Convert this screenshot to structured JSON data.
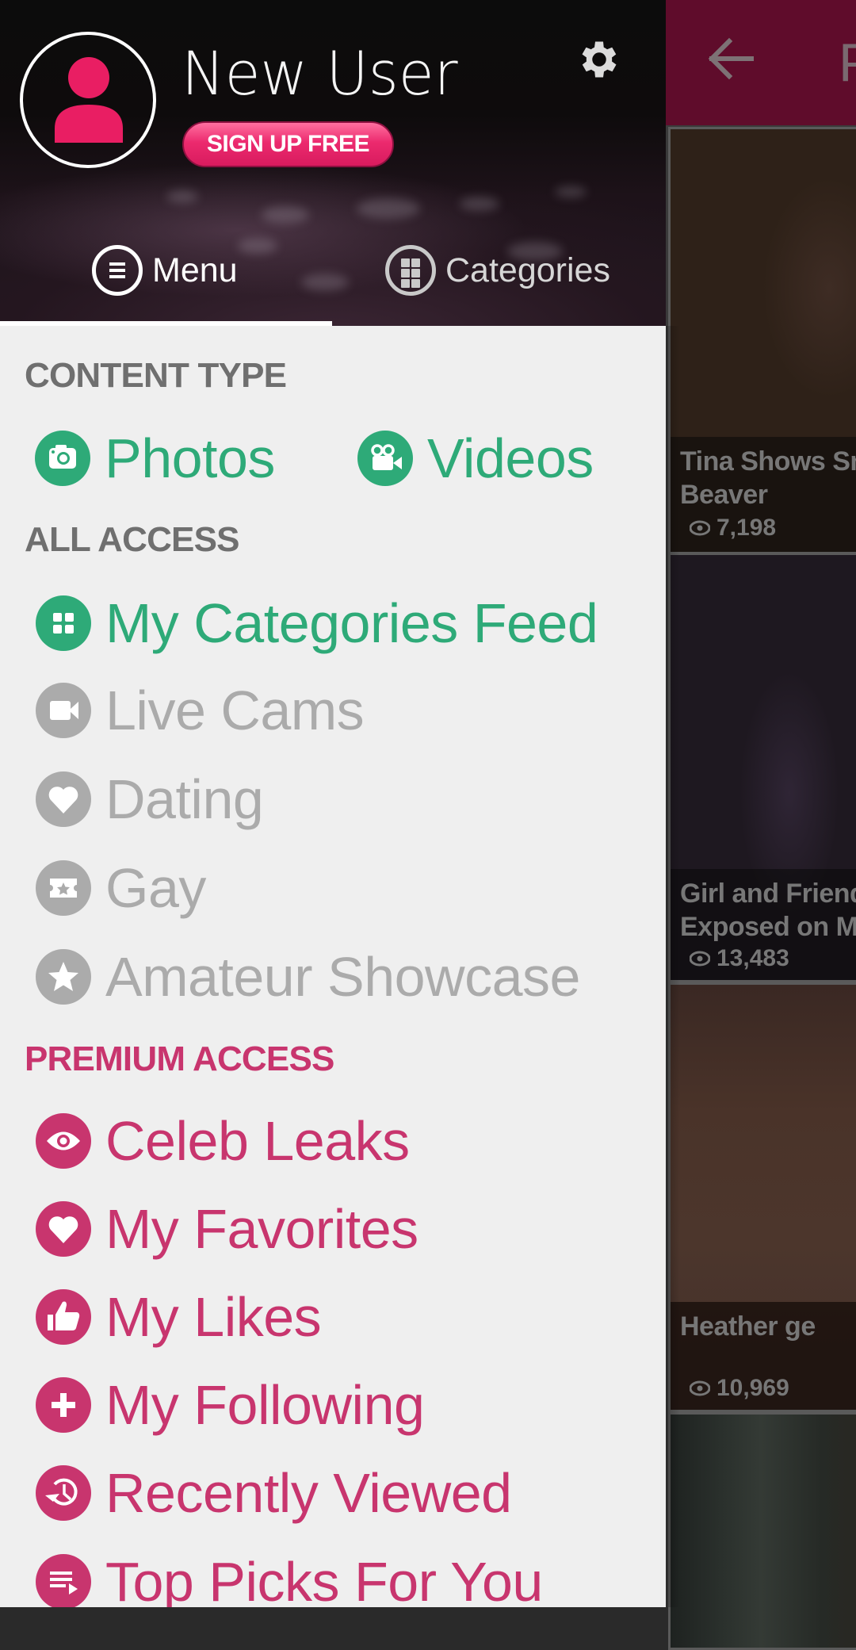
{
  "background_app": {
    "topbar": {
      "back_icon": "arrow-left-icon",
      "title_partial": "P"
    },
    "cards": [
      {
        "title": "Tina Shows Small Beaver",
        "title_visible": "Tina Shows Sma\nBeaver",
        "views": "7,198"
      },
      {
        "title": "Girl and Friend C… Exposed on Med…",
        "title_visible": "Girl and Friend C\nExposed on Mec",
        "views": "13,483"
      },
      {
        "title": "Heather ge…",
        "title_visible": "Heather ge",
        "views": "10,969"
      },
      {
        "title": "",
        "title_visible": "",
        "views": ""
      }
    ]
  },
  "drawer": {
    "header": {
      "user_name": "New User",
      "signup_label": "SIGN UP FREE",
      "avatar_icon": "person-icon",
      "settings_icon": "gear-icon",
      "colors": {
        "signup": "#ec2a6e",
        "avatar": "#e91e63"
      }
    },
    "tabs": [
      {
        "label": "Menu",
        "icon": "menu-icon",
        "active": true
      },
      {
        "label": "Categories",
        "icon": "grid-icon",
        "active": false
      }
    ],
    "sections": [
      {
        "title": "CONTENT TYPE",
        "color": "#6f6f6f",
        "items": [
          {
            "label": "Photos",
            "icon": "camera-icon",
            "state": "enabled",
            "color": "#2eaa78"
          },
          {
            "label": "Videos",
            "icon": "movie-camera-icon",
            "state": "enabled",
            "color": "#2eaa78"
          }
        ]
      },
      {
        "title": "ALL ACCESS",
        "color": "#6f6f6f",
        "items": [
          {
            "label": "My Categories Feed",
            "icon": "grid-icon",
            "state": "enabled",
            "color": "#2eaa78"
          },
          {
            "label": "Live Cams",
            "icon": "video-camera-icon",
            "state": "disabled",
            "color": "#ababab"
          },
          {
            "label": "Dating",
            "icon": "heart-icon",
            "state": "disabled",
            "color": "#ababab"
          },
          {
            "label": "Gay",
            "icon": "ticket-star-icon",
            "state": "disabled",
            "color": "#ababab"
          },
          {
            "label": "Amateur Showcase",
            "icon": "star-icon",
            "state": "disabled",
            "color": "#ababab"
          }
        ]
      },
      {
        "title": "PREMIUM ACCESS",
        "color": "#c8356e",
        "items": [
          {
            "label": "Celeb Leaks",
            "icon": "eye-icon",
            "state": "premium",
            "color": "#c8356e"
          },
          {
            "label": "My Favorites",
            "icon": "heart-icon",
            "state": "premium",
            "color": "#c8356e"
          },
          {
            "label": "My Likes",
            "icon": "thumbs-up-icon",
            "state": "premium",
            "color": "#c8356e"
          },
          {
            "label": "My Following",
            "icon": "plus-icon",
            "state": "premium",
            "color": "#c8356e"
          },
          {
            "label": "Recently Viewed",
            "icon": "history-icon",
            "state": "premium",
            "color": "#c8356e"
          },
          {
            "label": "Top Picks For You",
            "icon": "playlist-icon",
            "state": "premium",
            "color": "#c8356e"
          }
        ]
      }
    ]
  }
}
